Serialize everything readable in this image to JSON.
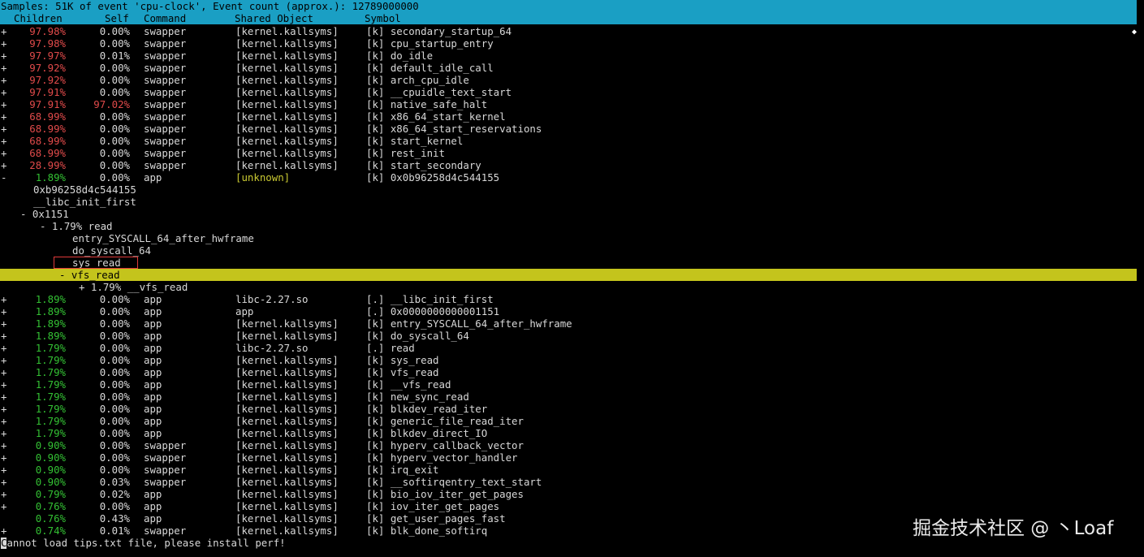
{
  "header": {
    "samples_line": "Samples: 51K of event 'cpu-clock', Event count (approx.): 12789000000",
    "col_children": "Children",
    "col_self": "Self",
    "col_command": "Command",
    "col_shared_object": "Shared Object",
    "col_symbol": "Symbol"
  },
  "top_rows": [
    {
      "exp": "+",
      "children": "97.98%",
      "self": "0.00%",
      "cmd": "swapper",
      "so": "[kernel.kallsyms]",
      "sym": "[k] secondary_startup_64",
      "color": "red"
    },
    {
      "exp": "+",
      "children": "97.98%",
      "self": "0.00%",
      "cmd": "swapper",
      "so": "[kernel.kallsyms]",
      "sym": "[k] cpu_startup_entry",
      "color": "red"
    },
    {
      "exp": "+",
      "children": "97.97%",
      "self": "0.01%",
      "cmd": "swapper",
      "so": "[kernel.kallsyms]",
      "sym": "[k] do_idle",
      "color": "red"
    },
    {
      "exp": "+",
      "children": "97.92%",
      "self": "0.00%",
      "cmd": "swapper",
      "so": "[kernel.kallsyms]",
      "sym": "[k] default_idle_call",
      "color": "red"
    },
    {
      "exp": "+",
      "children": "97.92%",
      "self": "0.00%",
      "cmd": "swapper",
      "so": "[kernel.kallsyms]",
      "sym": "[k] arch_cpu_idle",
      "color": "red"
    },
    {
      "exp": "+",
      "children": "97.91%",
      "self": "0.00%",
      "cmd": "swapper",
      "so": "[kernel.kallsyms]",
      "sym": "[k] __cpuidle_text_start",
      "color": "red"
    },
    {
      "exp": "+",
      "children": "97.91%",
      "self": "97.02%",
      "cmd": "swapper",
      "so": "[kernel.kallsyms]",
      "sym": "[k] native_safe_halt",
      "color": "red",
      "self_color": "red"
    },
    {
      "exp": "+",
      "children": "68.99%",
      "self": "0.00%",
      "cmd": "swapper",
      "so": "[kernel.kallsyms]",
      "sym": "[k] x86_64_start_kernel",
      "color": "red"
    },
    {
      "exp": "+",
      "children": "68.99%",
      "self": "0.00%",
      "cmd": "swapper",
      "so": "[kernel.kallsyms]",
      "sym": "[k] x86_64_start_reservations",
      "color": "red"
    },
    {
      "exp": "+",
      "children": "68.99%",
      "self": "0.00%",
      "cmd": "swapper",
      "so": "[kernel.kallsyms]",
      "sym": "[k] start_kernel",
      "color": "red"
    },
    {
      "exp": "+",
      "children": "68.99%",
      "self": "0.00%",
      "cmd": "swapper",
      "so": "[kernel.kallsyms]",
      "sym": "[k] rest_init",
      "color": "red"
    },
    {
      "exp": "+",
      "children": "28.99%",
      "self": "0.00%",
      "cmd": "swapper",
      "so": "[kernel.kallsyms]",
      "sym": "[k] start_secondary",
      "color": "red"
    },
    {
      "exp": "-",
      "children": "1.89%",
      "self": "0.00%",
      "cmd": "app",
      "so": "[unknown]",
      "sym": "[k] 0x0b96258d4c544155",
      "color": "green",
      "so_color": "yellow"
    }
  ],
  "callchain": [
    {
      "text": "0xb96258d4c544155",
      "indent": 41
    },
    {
      "text": "__libc_init_first",
      "indent": 41
    },
    {
      "text": "- 0x1151",
      "indent": 25
    },
    {
      "text": "- 1.79% read",
      "indent": 49
    },
    {
      "text": "entry_SYSCALL_64_after_hwframe",
      "indent": 89
    },
    {
      "text": "do_syscall_64",
      "indent": 89
    },
    {
      "text": "sys_read",
      "indent": 89
    },
    {
      "text": "- vfs_read",
      "indent": 73,
      "highlight": true
    },
    {
      "text": "+ 1.79% __vfs_read",
      "indent": 97
    }
  ],
  "bottom_rows": [
    {
      "exp": "+",
      "children": "1.89%",
      "self": "0.00%",
      "cmd": "app",
      "so": "libc-2.27.so",
      "sym": "[.] __libc_init_first",
      "color": "green"
    },
    {
      "exp": "+",
      "children": "1.89%",
      "self": "0.00%",
      "cmd": "app",
      "so": "app",
      "sym": "[.] 0x0000000000001151",
      "color": "green"
    },
    {
      "exp": "+",
      "children": "1.89%",
      "self": "0.00%",
      "cmd": "app",
      "so": "[kernel.kallsyms]",
      "sym": "[k] entry_SYSCALL_64_after_hwframe",
      "color": "green"
    },
    {
      "exp": "+",
      "children": "1.89%",
      "self": "0.00%",
      "cmd": "app",
      "so": "[kernel.kallsyms]",
      "sym": "[k] do_syscall_64",
      "color": "green"
    },
    {
      "exp": "+",
      "children": "1.79%",
      "self": "0.00%",
      "cmd": "app",
      "so": "libc-2.27.so",
      "sym": "[.] read",
      "color": "green"
    },
    {
      "exp": "+",
      "children": "1.79%",
      "self": "0.00%",
      "cmd": "app",
      "so": "[kernel.kallsyms]",
      "sym": "[k] sys_read",
      "color": "green"
    },
    {
      "exp": "+",
      "children": "1.79%",
      "self": "0.00%",
      "cmd": "app",
      "so": "[kernel.kallsyms]",
      "sym": "[k] vfs_read",
      "color": "green"
    },
    {
      "exp": "+",
      "children": "1.79%",
      "self": "0.00%",
      "cmd": "app",
      "so": "[kernel.kallsyms]",
      "sym": "[k] __vfs_read",
      "color": "green"
    },
    {
      "exp": "+",
      "children": "1.79%",
      "self": "0.00%",
      "cmd": "app",
      "so": "[kernel.kallsyms]",
      "sym": "[k] new_sync_read",
      "color": "green"
    },
    {
      "exp": "+",
      "children": "1.79%",
      "self": "0.00%",
      "cmd": "app",
      "so": "[kernel.kallsyms]",
      "sym": "[k] blkdev_read_iter",
      "color": "green"
    },
    {
      "exp": "+",
      "children": "1.79%",
      "self": "0.00%",
      "cmd": "app",
      "so": "[kernel.kallsyms]",
      "sym": "[k] generic_file_read_iter",
      "color": "green"
    },
    {
      "exp": "+",
      "children": "1.79%",
      "self": "0.00%",
      "cmd": "app",
      "so": "[kernel.kallsyms]",
      "sym": "[k] blkdev_direct_IO",
      "color": "green"
    },
    {
      "exp": "+",
      "children": "0.90%",
      "self": "0.00%",
      "cmd": "swapper",
      "so": "[kernel.kallsyms]",
      "sym": "[k] hyperv_callback_vector",
      "color": "green"
    },
    {
      "exp": "+",
      "children": "0.90%",
      "self": "0.00%",
      "cmd": "swapper",
      "so": "[kernel.kallsyms]",
      "sym": "[k] hyperv_vector_handler",
      "color": "green"
    },
    {
      "exp": "+",
      "children": "0.90%",
      "self": "0.00%",
      "cmd": "swapper",
      "so": "[kernel.kallsyms]",
      "sym": "[k] irq_exit",
      "color": "green"
    },
    {
      "exp": "+",
      "children": "0.90%",
      "self": "0.03%",
      "cmd": "swapper",
      "so": "[kernel.kallsyms]",
      "sym": "[k] __softirqentry_text_start",
      "color": "green"
    },
    {
      "exp": "+",
      "children": "0.79%",
      "self": "0.02%",
      "cmd": "app",
      "so": "[kernel.kallsyms]",
      "sym": "[k] bio_iov_iter_get_pages",
      "color": "green"
    },
    {
      "exp": "+",
      "children": "0.76%",
      "self": "0.00%",
      "cmd": "app",
      "so": "[kernel.kallsyms]",
      "sym": "[k] iov_iter_get_pages",
      "color": "green"
    },
    {
      "exp": "",
      "children": "0.76%",
      "self": "0.43%",
      "cmd": "app",
      "so": "[kernel.kallsyms]",
      "sym": "[k] get_user_pages_fast",
      "color": "green"
    },
    {
      "exp": "+",
      "children": "0.74%",
      "self": "0.01%",
      "cmd": "swapper",
      "so": "[kernel.kallsyms]",
      "sym": "[k] blk_done_softirq",
      "color": "green"
    }
  ],
  "status_first_char": "C",
  "status_rest": "annot load tips.txt file, please install perf!",
  "scroll_marker": "◆",
  "watermark": "掘金技术社区 @ 丶Loaf",
  "colors": {
    "header_bg": "#1a9fc4",
    "highlight_bg": "#c4c41c",
    "red": "#e04a4a",
    "green": "#33c033",
    "yellow": "#c8c832",
    "box": "#e03a3a"
  }
}
